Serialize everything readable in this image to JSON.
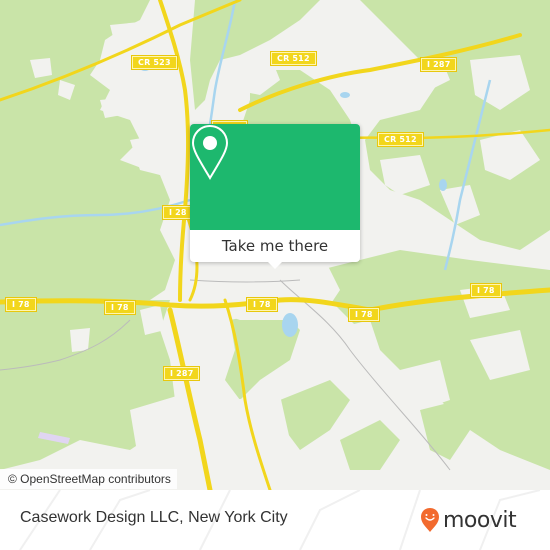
{
  "map": {
    "road_labels": [
      {
        "id": "cr523",
        "text": "CR 523"
      },
      {
        "id": "cr512-north",
        "text": "CR 512"
      },
      {
        "id": "i287-ne",
        "text": "I 287"
      },
      {
        "id": "cr512-east",
        "text": "CR 512"
      },
      {
        "id": "i287-top",
        "text": "I 287"
      },
      {
        "id": "i28-partial",
        "text": "I 28"
      },
      {
        "id": "i78-west",
        "text": "I 78"
      },
      {
        "id": "i78-junction",
        "text": "I 78"
      },
      {
        "id": "i78-center",
        "text": "I 78"
      },
      {
        "id": "i78-east",
        "text": "I 78"
      },
      {
        "id": "i78-far-east",
        "text": "I 78"
      },
      {
        "id": "i287-south",
        "text": "I 287"
      }
    ],
    "attribution": "© OpenStreetMap contributors",
    "colors": {
      "forest": "#c9e4a8",
      "urban": "#f2f2ef",
      "water": "#a8d5ef",
      "highway": "#f2d61c",
      "popup_green": "#1db86e",
      "brand_orange": "#f26a2e"
    }
  },
  "popup": {
    "icon": "location-pin-icon",
    "button_label": "Take me there"
  },
  "footer": {
    "place_name": "Casework Design LLC, New York City",
    "brand_icon": "moovit-logo-icon",
    "brand_name": "moovit"
  }
}
